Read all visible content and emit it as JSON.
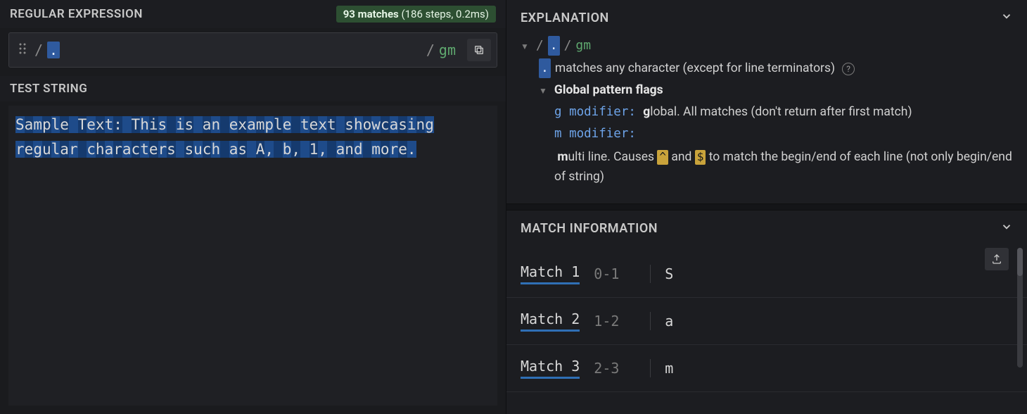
{
  "left": {
    "regex_header": "REGULAR EXPRESSION",
    "match_badge_bold": "93 matches",
    "match_badge_rest": " (186 steps, 0.2ms)",
    "slash1": "/",
    "pattern": ".",
    "slash2": "/",
    "flags": "gm",
    "test_header": "TEST STRING",
    "test_text": "Sample Text: This is an example text showcasing regular characters such as A, b, 1, and more."
  },
  "explanation": {
    "header": "EXPLANATION",
    "line1_slash1": "/",
    "line1_dot": ".",
    "line1_slash2": "/",
    "line1_flags": "gm",
    "dot_token": ".",
    "dot_desc": " matches any character (except for line terminators) ",
    "flags_title": "Global pattern flags",
    "g_mod_label": "g modifier:",
    "g_mod_bold": "g",
    "g_mod_rest": "lobal. All matches (don't return after first match)",
    "m_mod_label": "m modifier:",
    "m_mod_bold": "m",
    "m_mod_prefix": "ulti line. Causes ",
    "m_mod_tok1": "^",
    "m_mod_mid": " and ",
    "m_mod_tok2": "$",
    "m_mod_suffix": " to match the begin/end of each line (not only begin/end of string)"
  },
  "match_info": {
    "header": "MATCH INFORMATION",
    "rows": [
      {
        "label": "Match 1",
        "range": "0-1",
        "value": "S"
      },
      {
        "label": "Match 2",
        "range": "1-2",
        "value": "a"
      },
      {
        "label": "Match 3",
        "range": "2-3",
        "value": "m"
      }
    ]
  }
}
